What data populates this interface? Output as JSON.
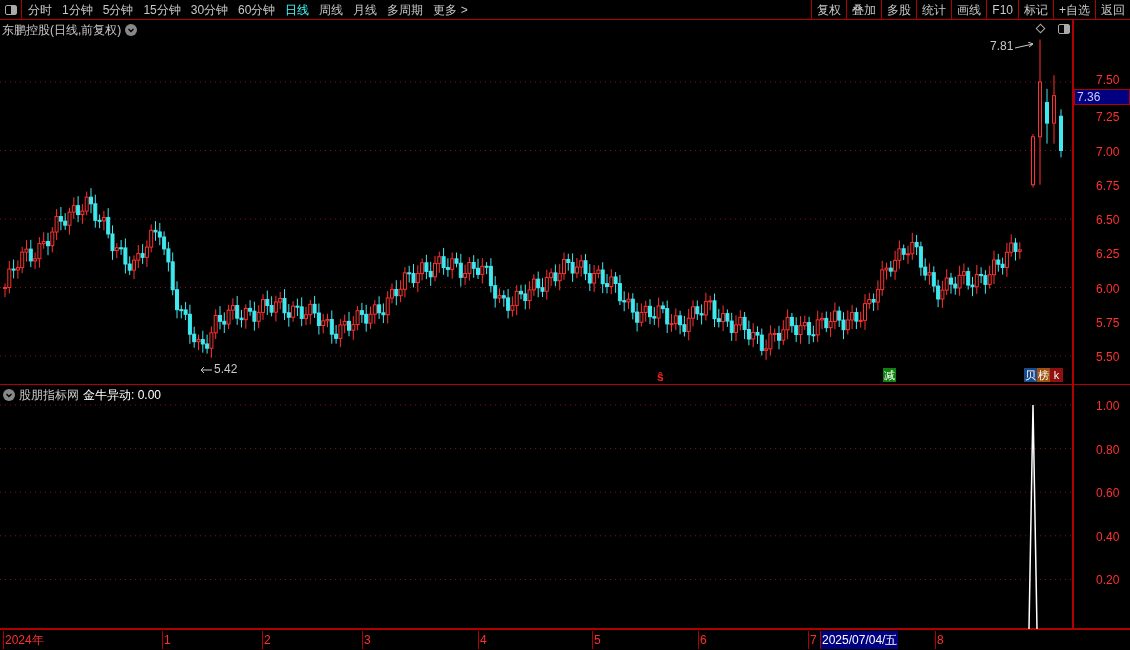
{
  "toolbar": {
    "periods": [
      {
        "label": "分时",
        "selected": false
      },
      {
        "label": "1分钟",
        "selected": false
      },
      {
        "label": "5分钟",
        "selected": false
      },
      {
        "label": "15分钟",
        "selected": false
      },
      {
        "label": "30分钟",
        "selected": false
      },
      {
        "label": "60分钟",
        "selected": false
      },
      {
        "label": "日线",
        "selected": true
      },
      {
        "label": "周线",
        "selected": false
      },
      {
        "label": "月线",
        "selected": false
      },
      {
        "label": "多周期",
        "selected": false
      },
      {
        "label": "更多 >",
        "selected": false
      }
    ],
    "buttons": [
      "复权",
      "叠加",
      "多股",
      "统计",
      "画线",
      "F10",
      "标记",
      "+自选",
      "返回"
    ]
  },
  "price_chart": {
    "title": "东鹏控股(日线,前复权)",
    "high_label": "7.81",
    "low_label": "5.42",
    "axis": [
      "7.50",
      "7.25",
      "7.00",
      "6.75",
      "6.50",
      "6.25",
      "6.00",
      "5.75",
      "5.50"
    ],
    "current_price": "7.36",
    "events": [
      {
        "text": "ŝ",
        "kind": "symbol",
        "color": "#ff2020"
      },
      {
        "text": "减",
        "kind": "badge",
        "color": "#108010"
      },
      {
        "text": "贝",
        "kind": "badge",
        "color": "#1a4a8a"
      },
      {
        "text": "榜",
        "kind": "badge",
        "color": "#a05010"
      },
      {
        "text": "k",
        "kind": "badge",
        "color": "#901010"
      }
    ]
  },
  "indicator": {
    "source": "股朋指标网",
    "name": "金牛异动: 0.00",
    "axis": [
      "1.00",
      "0.80",
      "0.60",
      "0.40",
      "0.20"
    ]
  },
  "date_axis": [
    {
      "label": "2024年",
      "selected": false
    },
    {
      "label": "1",
      "selected": false
    },
    {
      "label": "2",
      "selected": false
    },
    {
      "label": "3",
      "selected": false
    },
    {
      "label": "4",
      "selected": false
    },
    {
      "label": "5",
      "selected": false
    },
    {
      "label": "6",
      "selected": false
    },
    {
      "label": "7",
      "selected": false
    },
    {
      "label": "2025/07/04/五",
      "selected": true
    },
    {
      "label": "8",
      "selected": false
    }
  ]
}
